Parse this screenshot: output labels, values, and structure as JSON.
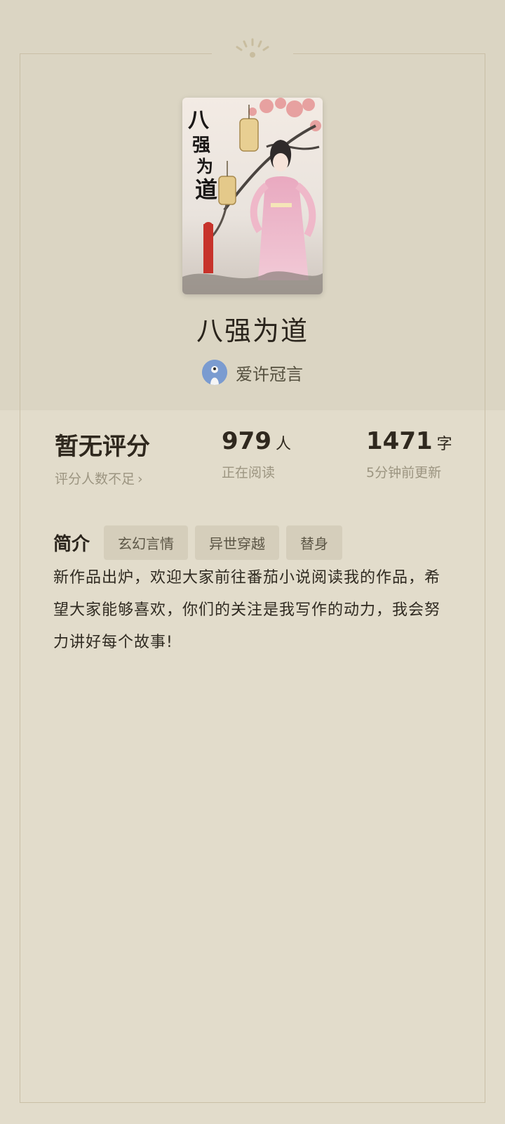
{
  "book": {
    "title": "八强为道",
    "cover_title_text": "八强为道"
  },
  "author": {
    "name": "爱许冠言"
  },
  "stats": {
    "rating": {
      "value": "暂无评分",
      "sub": "评分人数不足",
      "chevron": "›"
    },
    "readers": {
      "value": "979",
      "unit": "人",
      "sub": "正在阅读"
    },
    "words": {
      "value": "1471",
      "unit": "字",
      "sub": "5分钟前更新"
    }
  },
  "intro": {
    "label": "简介",
    "tags": [
      "玄幻言情",
      "异世穿越",
      "替身"
    ],
    "text": "新作品出炉，欢迎大家前往番茄小说阅读我的作品，希望大家能够喜欢，你们的关注是我写作的动力，我会努力讲好每个故事!"
  },
  "icons": {
    "ornament": "sunburst-ornament-icon",
    "chevron": "chevron-right-icon"
  },
  "colors": {
    "background": "#e2dccb",
    "top_band": "#dbd5c3",
    "frame": "#c9bfa6",
    "tag_bg": "#d5cebb",
    "avatar": "#6f93c9"
  }
}
